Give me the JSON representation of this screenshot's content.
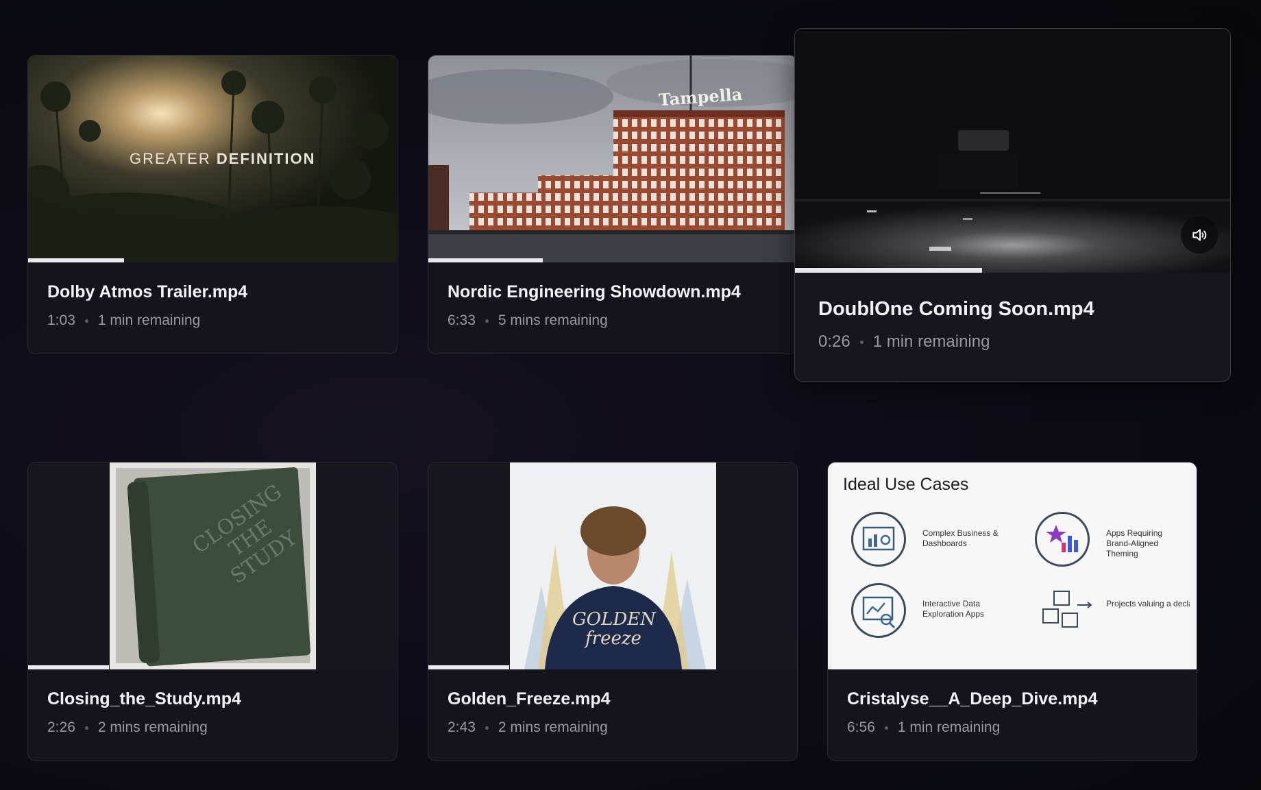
{
  "videos": [
    {
      "title": "Dolby Atmos Trailer.mp4",
      "duration": "1:03",
      "remaining": "1 min remaining",
      "progress": 0.26,
      "thumb_text_a": "GREATER ",
      "thumb_text_b": "DEFINITION"
    },
    {
      "title": "Nordic Engineering Showdown.mp4",
      "duration": "6:33",
      "remaining": "5 mins remaining",
      "progress": 0.31,
      "thumb_text": "Tampella"
    },
    {
      "title": "DoublOne Coming Soon.mp4",
      "duration": "0:26",
      "remaining": "1 min remaining",
      "progress": 0.43
    },
    {
      "title": "Closing_the_Study.mp4",
      "duration": "2:26",
      "remaining": "2 mins remaining",
      "progress": 0.22,
      "book_lines": [
        "CLOSING",
        "THE",
        "STUDY"
      ]
    },
    {
      "title": "Golden_Freeze.mp4",
      "duration": "2:43",
      "remaining": "2 mins remaining",
      "progress": 0.22,
      "hoodie_lines": [
        "GOLDEN",
        "freeze"
      ]
    },
    {
      "title": "Cristalyse__A_Deep_Dive.mp4",
      "duration": "6:56",
      "remaining": "1 min remaining",
      "progress": 0.01,
      "slide": {
        "heading": "Ideal Use Cases",
        "items": [
          "Complex Business & Dashboards",
          "Apps Requiring Brand-Aligned Theming",
          "Interactive Data Exploration Apps",
          "Projects valuing a declarative, systemat approach"
        ]
      }
    }
  ]
}
